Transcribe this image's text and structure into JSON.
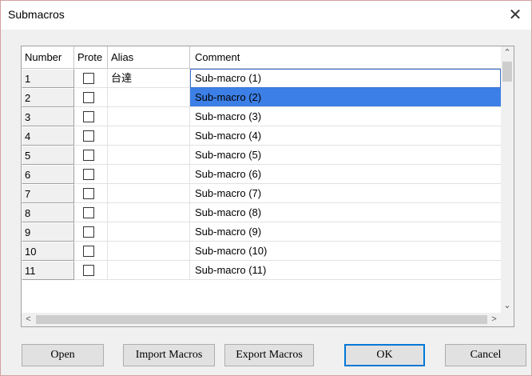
{
  "window": {
    "title": "Submacros",
    "close_glyph": "✕"
  },
  "grid": {
    "headers": {
      "number": "Number",
      "protect": "Prote",
      "alias": "Alias",
      "comment": "Comment"
    },
    "rows": [
      {
        "number": "1",
        "alias": "台達",
        "comment": "Sub-macro (1)"
      },
      {
        "number": "2",
        "alias": "",
        "comment": "Sub-macro (2)"
      },
      {
        "number": "3",
        "alias": "",
        "comment": "Sub-macro (3)"
      },
      {
        "number": "4",
        "alias": "",
        "comment": "Sub-macro (4)"
      },
      {
        "number": "5",
        "alias": "",
        "comment": "Sub-macro (5)"
      },
      {
        "number": "6",
        "alias": "",
        "comment": "Sub-macro (6)"
      },
      {
        "number": "7",
        "alias": "",
        "comment": "Sub-macro (7)"
      },
      {
        "number": "8",
        "alias": "",
        "comment": "Sub-macro (8)"
      },
      {
        "number": "9",
        "alias": "",
        "comment": "Sub-macro (9)"
      },
      {
        "number": "10",
        "alias": "",
        "comment": "Sub-macro (10)"
      },
      {
        "number": "11",
        "alias": "",
        "comment": "Sub-macro (11)"
      }
    ],
    "selected_row": "2",
    "focused_row": "1"
  },
  "buttons": {
    "open": "Open",
    "import": "Import Macros",
    "export": "Export Macros",
    "ok": "OK",
    "cancel": "Cancel"
  },
  "colors": {
    "selection": "#3c7fe6",
    "focus": "#3c6fd0",
    "default_button_border": "#0078d7"
  }
}
